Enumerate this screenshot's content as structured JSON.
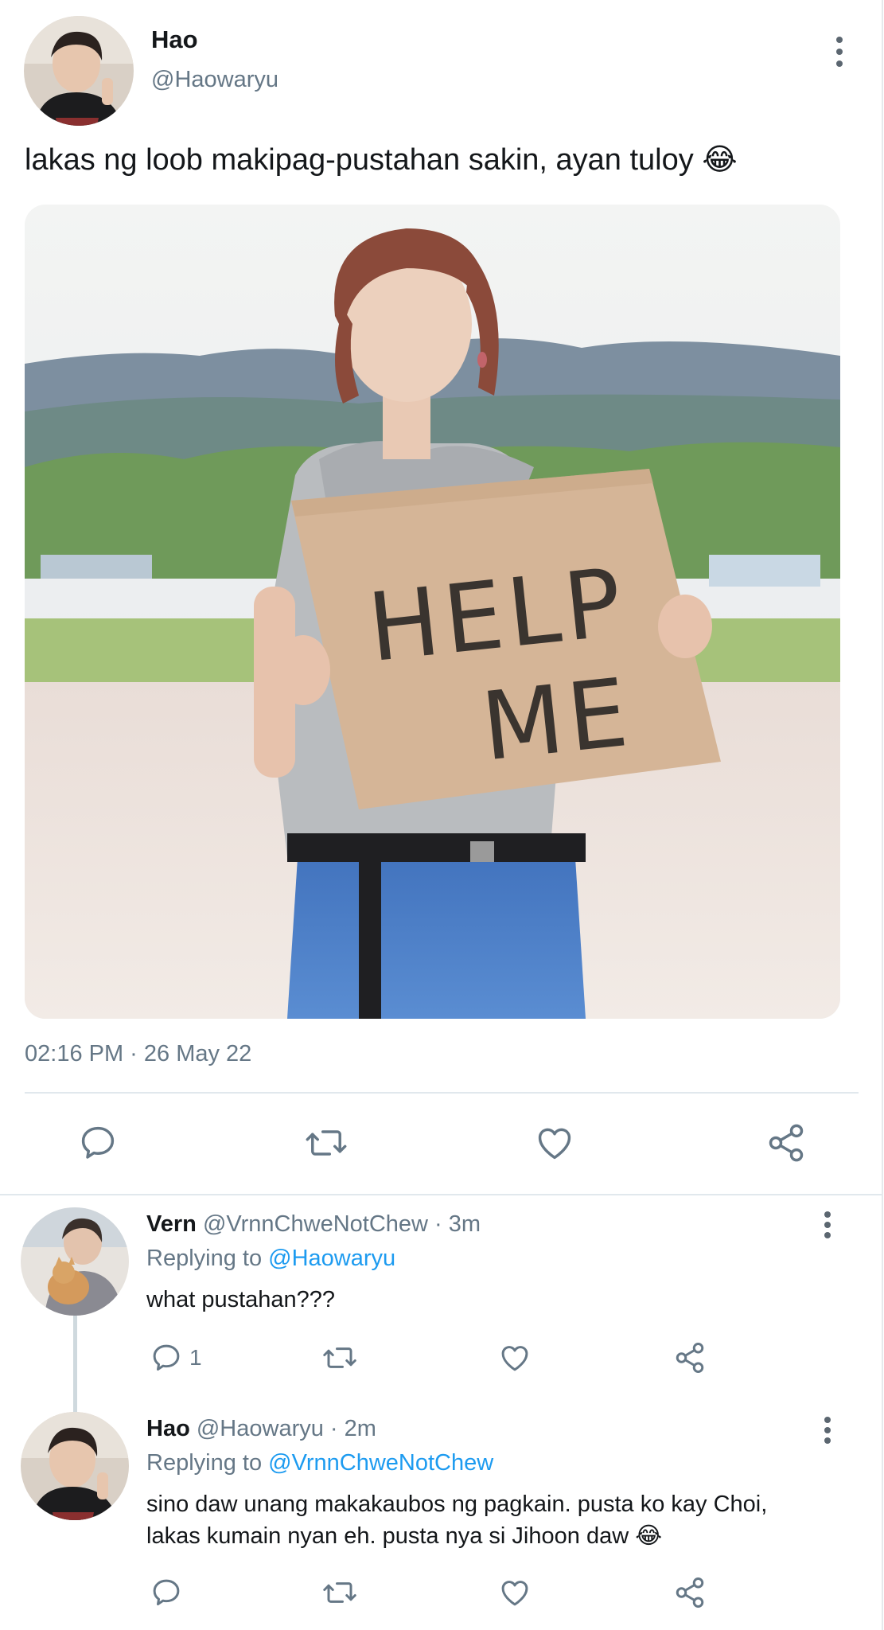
{
  "tweet": {
    "author_name": "Hao",
    "author_handle": "@Haowaryu",
    "text": "lakas ng loob makipag-pustahan sakin, ayan tuloy 😂",
    "image": {
      "sign_line1": "HELP",
      "sign_line2": "ME"
    },
    "timestamp": "02:16 PM · 26 May 22"
  },
  "actions": [
    "reply-icon",
    "retweet-icon",
    "like-icon",
    "share-icon"
  ],
  "replies": [
    {
      "author_name": "Vern",
      "author_handle": "@VrnnChweNotChew · 3m",
      "replying_prefix": "Replying to ",
      "replying_to": "@Haowaryu",
      "text": "what pustahan???",
      "reply_count": "1"
    },
    {
      "author_name": "Hao",
      "author_handle": "@Haowaryu · 2m",
      "replying_prefix": "Replying to ",
      "replying_to": "@VrnnChweNotChew",
      "text_line1": "sino daw unang makakaubos ng pagkain. pusta ko kay Choi,",
      "text_line2": "lakas kumain nyan eh. pusta nya si Jihoon daw 😂"
    }
  ],
  "colors": {
    "link": "#1d9bf0",
    "muted": "#657786",
    "icon": "#657786"
  }
}
